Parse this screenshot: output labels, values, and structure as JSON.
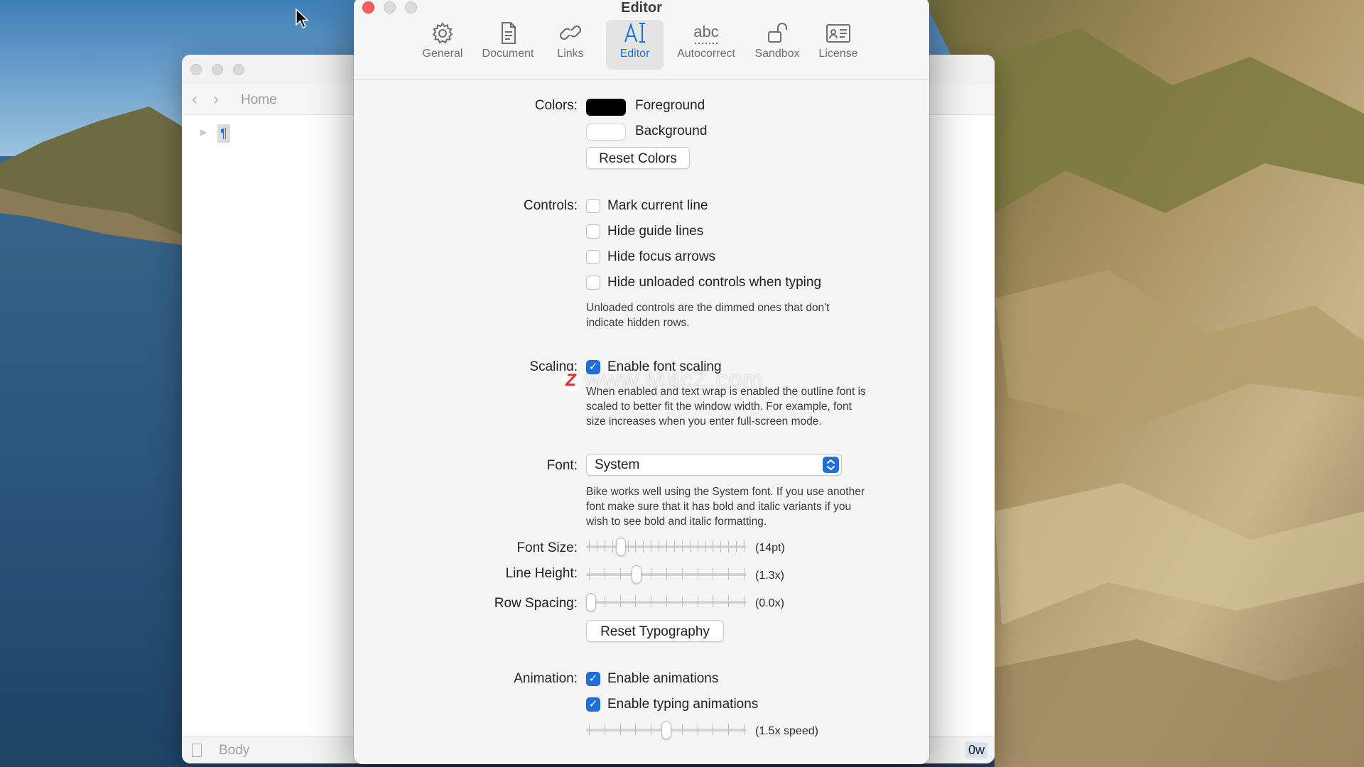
{
  "colors": {
    "accent": "#1f6fd8",
    "close": "#ff5f57",
    "foreground_swatch": "#000000",
    "background_swatch": "#ffffff"
  },
  "background_window": {
    "breadcrumb": "Home",
    "pilcrow": "¶",
    "status_style": "Body",
    "status_count": "0w"
  },
  "prefs": {
    "title": "Editor",
    "tabs": [
      {
        "label": "General",
        "icon": "gear-icon"
      },
      {
        "label": "Document",
        "icon": "document-icon"
      },
      {
        "label": "Links",
        "icon": "link-icon"
      },
      {
        "label": "Editor",
        "icon": "text-cursor-icon",
        "selected": true
      },
      {
        "label": "Autocorrect",
        "icon": "abc-icon"
      },
      {
        "label": "Sandbox",
        "icon": "unlock-icon"
      },
      {
        "label": "License",
        "icon": "id-card-icon"
      }
    ],
    "colors": {
      "label": "Colors:",
      "foreground": "Foreground",
      "background": "Background",
      "reset": "Reset Colors"
    },
    "controls": {
      "label": "Controls:",
      "options": [
        {
          "label": "Mark current line",
          "checked": false
        },
        {
          "label": "Hide guide lines",
          "checked": false
        },
        {
          "label": "Hide focus arrows",
          "checked": false
        },
        {
          "label": "Hide unloaded controls when typing",
          "checked": false
        }
      ],
      "help_1": "Unloaded controls are the dimmed ones that don't",
      "help_2": "indicate hidden rows."
    },
    "scaling": {
      "label": "Scaling:",
      "option": "Enable font scaling",
      "checked": true,
      "help_1": "When enabled and text wrap is enabled the outline font is",
      "help_2": "scaled to better fit the window width. For example, font",
      "help_3": "size increases when you enter full-screen mode."
    },
    "font": {
      "label": "Font:",
      "value": "System",
      "help_1": "Bike works well using the System font. If you use another",
      "help_2": "font make sure that it has bold and italic variants if you",
      "help_3": "wish to see bold and italic formatting."
    },
    "typography": {
      "font_size_label": "Font Size:",
      "font_size_value": "(14pt)",
      "font_size_level": 0.2,
      "line_height_label": "Line Height:",
      "line_height_value": "(1.3x)",
      "line_height_level": 0.3,
      "row_spacing_label": "Row Spacing:",
      "row_spacing_value": "(0.0x)",
      "row_spacing_level": 0.0,
      "reset": "Reset Typography"
    },
    "animation": {
      "label": "Animation:",
      "enable": "Enable animations",
      "enable_checked": true,
      "typing": "Enable typing animations",
      "typing_checked": true,
      "speed_value": "(1.5x speed)",
      "speed_level": 0.5
    }
  },
  "watermark": {
    "logo_letter": "Z",
    "text": "www.MacZ.com"
  }
}
